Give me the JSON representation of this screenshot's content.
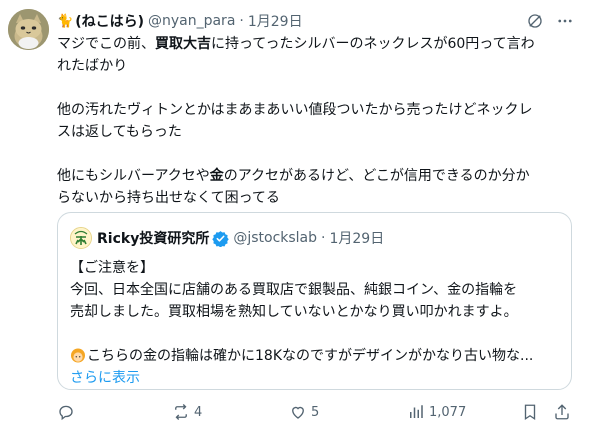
{
  "author": {
    "avatar_emoji": "cat",
    "header_icon": "🐈",
    "display_name": "(ねこはら)",
    "handle": "@nyan_para",
    "separator": "·",
    "time": "1月29日"
  },
  "header_icons": [
    "grok-icon",
    "more-options-icon"
  ],
  "body": {
    "line1_a": "マジでこの前、",
    "line1_bold": "買取大吉",
    "line1_b": "に持ってったシルバーのネックレスが60円って言わ",
    "line2": "れたばかり",
    "line3": "他の汚れたヴィトンとかはまあまあいい値段ついたから売ったけどネックレ",
    "line4": "スは返してもらった",
    "line5_a": "他にもシルバーアクセや",
    "line5_bold": "金",
    "line5_b": "のアクセがあるけど、どこが信用できるのか分か",
    "line6": "らないから持ち出せなくて困ってる"
  },
  "quote": {
    "display_name": "Ricky投資研究所",
    "handle": "@jstockslab",
    "separator": "·",
    "time": "1月29日",
    "line1": "【ご注意を】",
    "line2": "今回、日本全国に店舗のある買取店で銀製品、純銀コイン、金の指輪を",
    "line3": "売却しました。買取相場を熟知していないとかなり買い叩かれますよ。",
    "line4": "こちらの金の指輪は確かに18Kなのですがデザインがかなり古い物な...",
    "show_more": "さらに表示",
    "verified_color": "#1d9bf0"
  },
  "actions": {
    "reply_count": "",
    "repost_count": "4",
    "like_count": "5",
    "views_count": "1,077"
  },
  "colors": {
    "text": "#0f1419",
    "muted": "#536471",
    "link": "#1d9bf0",
    "border": "#cfd9de"
  }
}
